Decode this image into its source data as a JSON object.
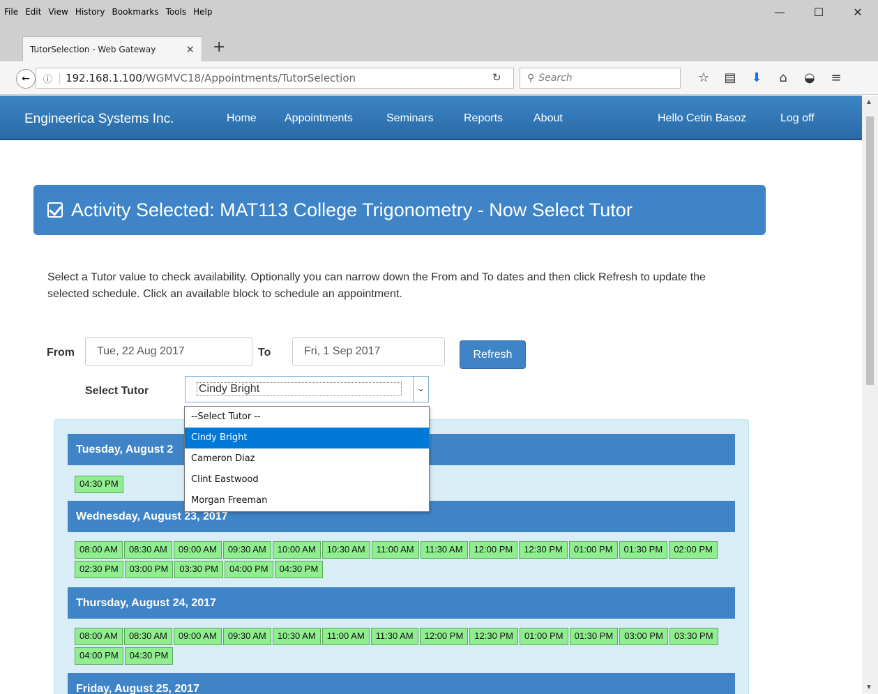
{
  "browser": {
    "menus": [
      "File",
      "Edit",
      "View",
      "History",
      "Bookmarks",
      "Tools",
      "Help"
    ],
    "window_controls": [
      "—",
      "☐",
      "✕"
    ],
    "tab_title": "TutorSelection - Web Gateway",
    "tab_close": "✕",
    "new_tab": "+",
    "back": "←",
    "url_info": "ⓘ",
    "url_host": "192.168.1.100",
    "url_path": "/WGMVC18/Appointments/TutorSelection",
    "reload": "↻",
    "search_icon": "🔍",
    "search_placeholder": "Search",
    "toolbar_icons": [
      "☆",
      "▤",
      "⬇",
      "⌂",
      "◒",
      "≡"
    ]
  },
  "site": {
    "brand": "Engineerica Systems Inc.",
    "nav": [
      "Home",
      "Appointments",
      "Seminars",
      "Reports",
      "About"
    ],
    "greeting": "Hello Cetin Basoz",
    "logoff": "Log off",
    "accent_color": "#3f84c6"
  },
  "page": {
    "title": "Activity Selected: MAT113 College Trigonometry - Now Select Tutor",
    "instructions": "Select a Tutor value to check availability. Optionally you can narrow down the From and To dates and then click Refresh to update the selected schedule. Click an available block to schedule an appointment.",
    "from_label": "From",
    "from_value": "Tue, 22 Aug 2017",
    "to_label": "To",
    "to_value": "Fri, 1 Sep 2017",
    "refresh_label": "Refresh",
    "select_tutor_label": "Select Tutor",
    "select_tutor_value": "Cindy Bright",
    "tutor_options": [
      "--Select Tutor --",
      "Cindy Bright",
      "Cameron Diaz",
      "Clint Eastwood",
      "Morgan Freeman"
    ],
    "selected_option_index": 1
  },
  "schedule": {
    "slot_color": "#90ee90",
    "days": [
      {
        "heading": "Tuesday, August 2",
        "slots": [
          "04:30 PM"
        ]
      },
      {
        "heading": "Wednesday, August 23, 2017",
        "slots": [
          "08:00 AM",
          "08:30 AM",
          "09:00 AM",
          "09:30 AM",
          "10:00 AM",
          "10:30 AM",
          "11:00 AM",
          "11:30 AM",
          "12:00 PM",
          "12:30 PM",
          "01:00 PM",
          "01:30 PM",
          "02:00 PM",
          "02:30 PM",
          "03:00 PM",
          "03:30 PM",
          "04:00 PM",
          "04:30 PM"
        ]
      },
      {
        "heading": "Thursday, August 24, 2017",
        "slots": [
          "08:00 AM",
          "08:30 AM",
          "09:00 AM",
          "09:30 AM",
          "10:30 AM",
          "11:00 AM",
          "11:30 AM",
          "12:00 PM",
          "12:30 PM",
          "01:00 PM",
          "01:30 PM",
          "03:00 PM",
          "03:30 PM",
          "04:00 PM",
          "04:30 PM"
        ]
      },
      {
        "heading": "Friday, August 25, 2017",
        "slots": []
      }
    ]
  }
}
